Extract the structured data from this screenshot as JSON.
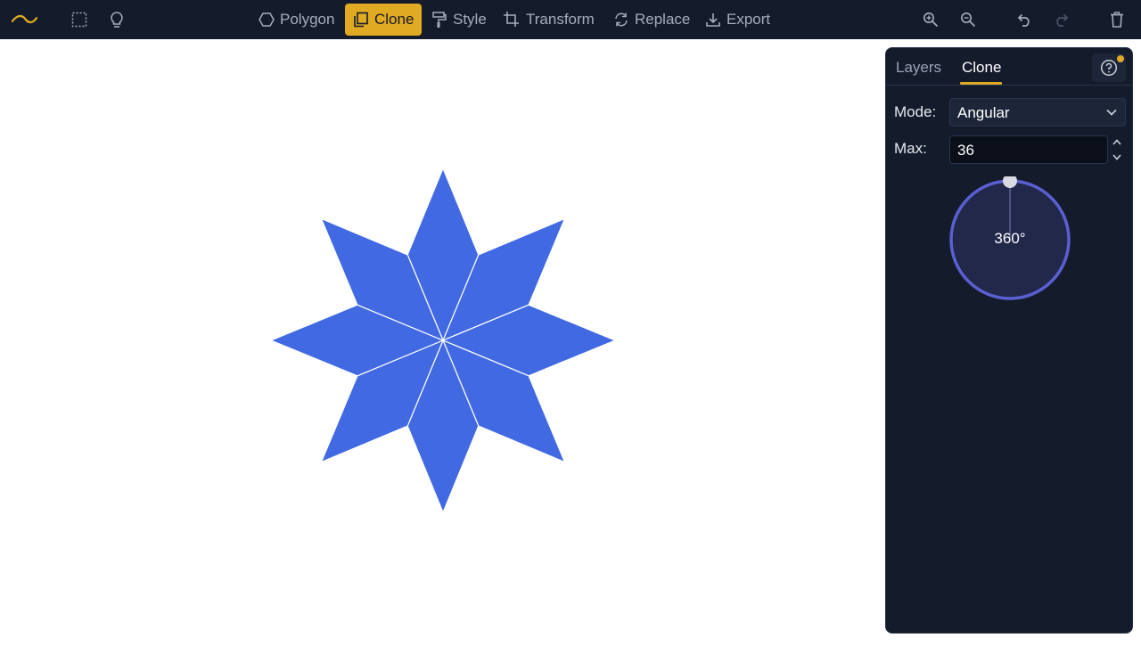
{
  "toolbar": {
    "logo_icon": "logo-swoosh-icon",
    "select_icon": "marquee-select-icon",
    "hint_icon": "lightbulb-icon",
    "buttons": [
      {
        "label": "Polygon",
        "icon": "hexagon-icon",
        "active": false
      },
      {
        "label": "Clone",
        "icon": "clone-icon",
        "active": true
      },
      {
        "label": "Style",
        "icon": "paint-roller-icon",
        "active": false
      },
      {
        "label": "Transform",
        "icon": "crop-icon",
        "active": false
      },
      {
        "label": "Replace",
        "icon": "replace-icon",
        "active": false
      },
      {
        "label": "Export",
        "icon": "download-icon",
        "active": false
      }
    ],
    "right_icons": [
      "zoom-in-icon",
      "zoom-out-icon",
      "undo-icon",
      "redo-icon",
      "trash-icon"
    ]
  },
  "canvas": {
    "shape": "eight-point-star",
    "fill_color": "#4169e1",
    "stroke_color": "#ffffff",
    "copies": 8
  },
  "panel": {
    "tabs": [
      {
        "label": "Layers",
        "active": false
      },
      {
        "label": "Clone",
        "active": true
      }
    ],
    "help_icon": "help-circle-icon",
    "mode": {
      "label": "Mode:",
      "value": "Angular"
    },
    "max": {
      "label": "Max:",
      "value": "36"
    },
    "dial": {
      "value": "360°",
      "angle_degrees": 360
    }
  },
  "colors": {
    "toolbar_bg": "#141b2b",
    "accent": "#e0aa22",
    "panel_bg": "#141b2b",
    "dial_ring": "#5a5fd1",
    "dial_fill": "#22284a"
  }
}
